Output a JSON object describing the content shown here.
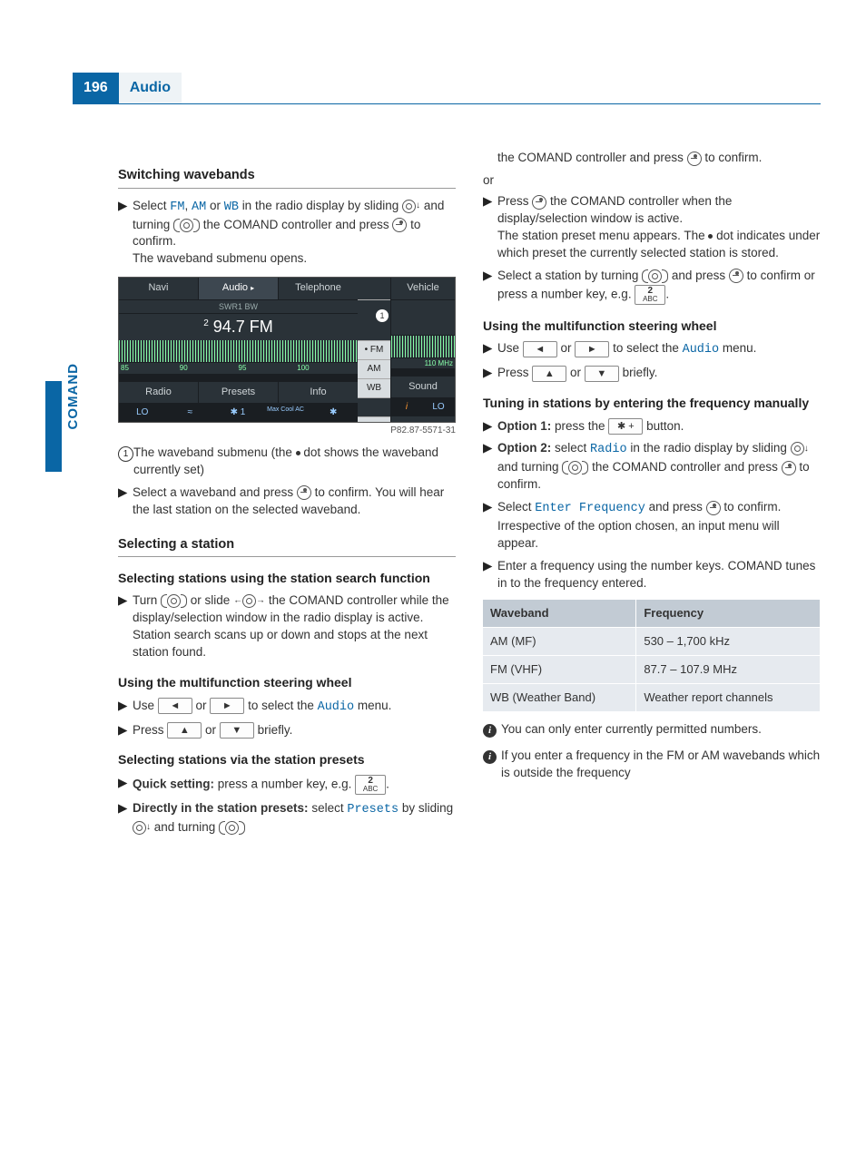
{
  "header": {
    "page_number": "196",
    "title": "Audio",
    "side_label": "COMAND"
  },
  "screenshot": {
    "top_tabs": [
      "Navi",
      "Audio",
      "Telephone",
      "",
      "Vehicle"
    ],
    "sub_label": "SWR1 BW",
    "preset_num": "2",
    "frequency": "94.7 FM",
    "scale_labels": [
      "85",
      "90",
      "95",
      "100",
      "110 MHz"
    ],
    "submenu": [
      "• FM",
      "AM",
      "WB"
    ],
    "bottom_tabs_left": [
      "Radio",
      "Presets",
      "Info"
    ],
    "bottom_tabs_right": "Sound",
    "footer_left": "LO",
    "footer_mid1": "≈",
    "footer_mid2": "✱ 1",
    "footer_mid3": "Max Cool AC",
    "footer_mid4": "✱",
    "footer_right_i": "i",
    "footer_right": "LO",
    "callout": "1",
    "caption": "P82.87-5571-31"
  },
  "col1": {
    "h_switching": "Switching wavebands",
    "step1a": "Select ",
    "fm": "FM",
    "am": "AM",
    "wb": "WB",
    "step1b": " in the radio display by sliding ",
    "step1c": " and turning ",
    "step1d": " the COMAND controller and press ",
    "step1e": " to confirm.",
    "step1f": "The waveband submenu opens.",
    "callout_text": "The waveband submenu (the ",
    "callout_text2": " dot shows the waveband currently set)",
    "step2a": "Select a waveband and press ",
    "step2b": " to confirm. You will hear the last station on the selected waveband.",
    "h_selecting": "Selecting a station",
    "h_search": "Selecting stations using the station search function",
    "search1a": "Turn ",
    "search1b": " or slide ",
    "search1c": " the COMAND controller while the display/selection window in the radio display is active. Station search scans up or down and stops at the next station found.",
    "h_multi1": "Using the multifunction steering wheel",
    "multi1a": "Use ",
    "multi1b": " or ",
    "multi1c": " to select the ",
    "audio_word": "Audio",
    "multi1d": " menu.",
    "multi2a": "Press ",
    "multi2b": " or ",
    "multi2c": " briefly.",
    "h_presets": "Selecting stations via the station presets",
    "preset1a": "Quick setting:",
    "preset1b": " press a number key, e.g. ",
    "preset2a": "Directly in the station presets:",
    "preset2b": " select ",
    "presets_word": "Presets",
    "preset2c": " by sliding ",
    "preset2d": " and turning "
  },
  "col2": {
    "cont1a": "the COMAND controller and press ",
    "cont1b": " to confirm.",
    "or": "or",
    "cont2a": "Press ",
    "cont2b": " the COMAND controller when the display/selection window is active.",
    "cont2c": "The station preset menu appears. The ",
    "cont2d": " dot indicates under which preset the currently selected station is stored.",
    "cont3a": "Select a station by turning ",
    "cont3b": " and press ",
    "cont3c": " to confirm or press a number key, e.g. ",
    "h_multi2": "Using the multifunction steering wheel",
    "m2_1a": "Use ",
    "m2_1b": " or ",
    "m2_1c": " to select the ",
    "m2_1d": " menu.",
    "m2_2a": "Press ",
    "m2_2b": " or ",
    "m2_2c": " briefly.",
    "h_tuning": "Tuning in stations by entering the frequency manually",
    "opt1a": "Option 1:",
    "opt1b": " press the ",
    "opt1c": " button.",
    "opt2a": "Option 2:",
    "opt2b": " select ",
    "radio_word": "Radio",
    "opt2c": " in the radio display by sliding ",
    "opt2d": " and turning ",
    "opt2e": " the COMAND controller and press ",
    "opt2f": " to confirm.",
    "ef1a": "Select ",
    "ef_word": "Enter Frequency",
    "ef1b": " and press ",
    "ef1c": " to confirm.",
    "ef1d": "Irrespective of the option chosen, an input menu will appear.",
    "ef2": "Enter a frequency using the number keys. COMAND tunes in to the frequency entered.",
    "table": {
      "h1": "Waveband",
      "h2": "Frequency",
      "r1c1": "AM (MF)",
      "r1c2": "530 – 1,700 kHz",
      "r2c1": "FM (VHF)",
      "r2c2": "87.7 – 107.9 MHz",
      "r3c1": "WB (Weather Band)",
      "r3c2": "Weather report channels"
    },
    "note1": "You can only enter currently permitted numbers.",
    "note2": "If you enter a frequency in the FM or AM wavebands which is outside the frequency"
  },
  "keys": {
    "star_plus": "✱  +",
    "two": "2",
    "abc": "ABC"
  }
}
